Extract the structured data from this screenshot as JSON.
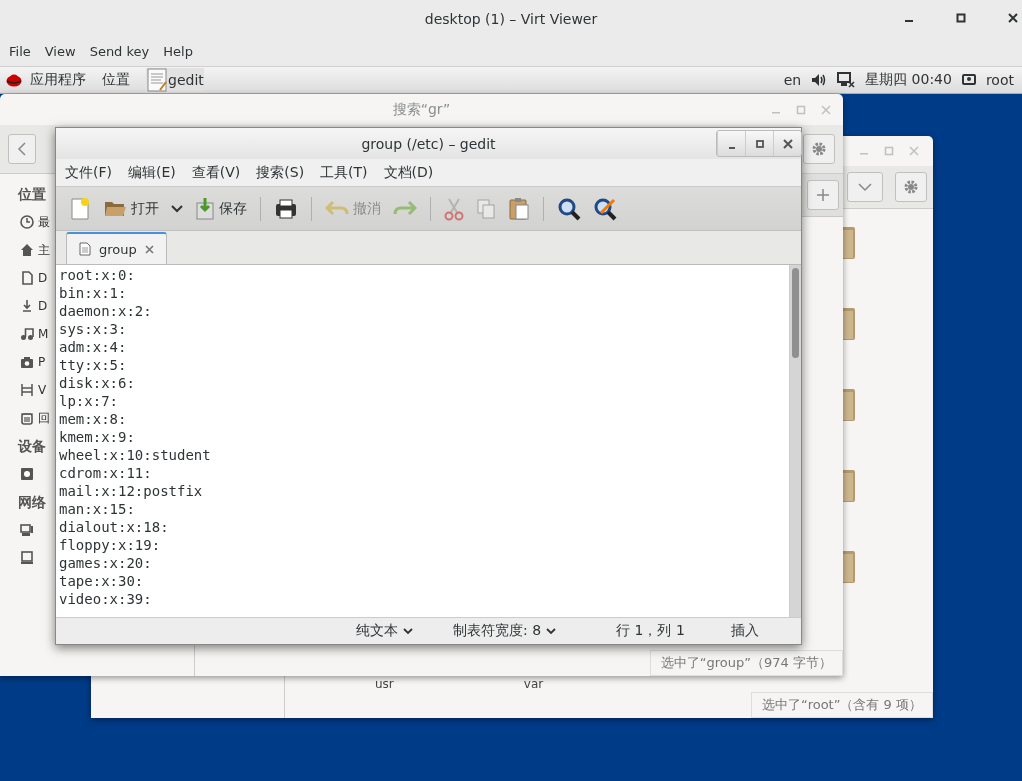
{
  "viewer": {
    "title": "desktop (1) – Virt Viewer",
    "menu": [
      "File",
      "View",
      "Send key",
      "Help"
    ]
  },
  "top_bar": {
    "apps": "应用程序",
    "places": "位置",
    "task": "gedit",
    "lang": "en",
    "clock": "星期四 00:40",
    "user": "root"
  },
  "files_window": {
    "items": [
      "usr",
      "var"
    ],
    "status": "选中了“root”（含有 9 项）"
  },
  "search_window": {
    "title": "搜索“gr”",
    "status": "选中了“group”（974 字节）",
    "sections": [
      {
        "heading": "位置",
        "items": [
          {
            "kind": "place",
            "label": "最"
          },
          {
            "kind": "place",
            "label": "主"
          },
          {
            "kind": "place",
            "label": "D"
          },
          {
            "kind": "place",
            "label": "D"
          },
          {
            "kind": "place",
            "label": "M"
          },
          {
            "kind": "place",
            "label": "P"
          },
          {
            "kind": "place",
            "label": "V"
          },
          {
            "kind": "place",
            "label": "回"
          }
        ]
      },
      {
        "heading": "设备",
        "items": [
          {
            "kind": "drive"
          }
        ]
      },
      {
        "heading": "网络",
        "items": [
          {
            "kind": "network"
          },
          {
            "kind": "server"
          }
        ]
      }
    ]
  },
  "gedit": {
    "title": "group (/etc) – gedit",
    "menu": [
      "文件(F)",
      "编辑(E)",
      "查看(V)",
      "搜索(S)",
      "工具(T)",
      "文档(D)"
    ],
    "toolbar": {
      "open": {
        "label": "打开"
      },
      "save": {
        "label": "保存"
      },
      "undo": {
        "label": "撤消",
        "disabled": true
      },
      "redo": {
        "disabled": true
      },
      "cut": {
        "disabled": true
      },
      "copy": {
        "disabled": true
      },
      "paste": {
        "disabled": false
      }
    },
    "tabs": [
      {
        "label": "group",
        "selected": true
      }
    ],
    "lines": [
      "root:x:0:",
      "bin:x:1:",
      "daemon:x:2:",
      "sys:x:3:",
      "adm:x:4:",
      "tty:x:5:",
      "disk:x:6:",
      "lp:x:7:",
      "mem:x:8:",
      "kmem:x:9:",
      "wheel:x:10:student",
      "cdrom:x:11:",
      "mail:x:12:postfix",
      "man:x:15:",
      "dialout:x:18:",
      "floppy:x:19:",
      "games:x:20:",
      "tape:x:30:",
      "video:x:39:"
    ],
    "status": {
      "language": "纯文本",
      "tab_width": "制表符宽度: 8",
      "position": "行 1，列 1",
      "mode": "插入"
    }
  }
}
